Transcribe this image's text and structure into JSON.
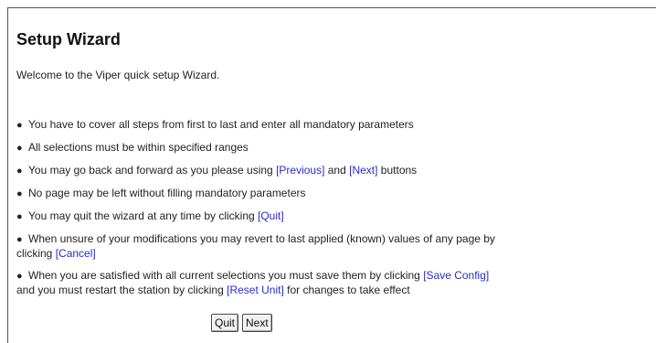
{
  "page": {
    "title": "Setup Wizard",
    "welcome": "Welcome to the Viper quick setup Wizard."
  },
  "rules": [
    {
      "text": "You have to cover all steps from first to last and enter all mandatory parameters"
    },
    {
      "text": "All selections must be within specified ranges"
    },
    {
      "pre": "You may go back and forward as you please using ",
      "link1": "[Previous]",
      "mid": " and ",
      "link2": "[Next]",
      "post": " buttons"
    },
    {
      "text": "No page may be left without filling mandatory parameters"
    },
    {
      "pre": "You may quit the wizard at any time by clicking ",
      "link1": "[Quit]"
    },
    {
      "pre": "When unsure of your modifications you may revert to last applied (known) values of any page by clicking ",
      "link1": "[Cancel]"
    },
    {
      "pre": "When you are satisfied with all current selections you must save them by clicking ",
      "link1": "[Save Config]",
      "mid": " and you must restart the station by clicking ",
      "link2": "[Reset Unit]",
      "post": " for changes to take effect"
    }
  ],
  "buttons": {
    "quit": "Quit",
    "next": "Next"
  },
  "colors": {
    "link": "#2a2ad0",
    "text": "#222222"
  }
}
